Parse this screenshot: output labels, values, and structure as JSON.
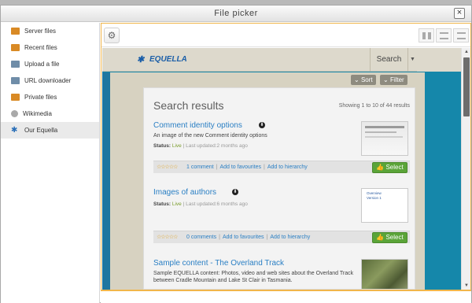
{
  "window": {
    "title": "File picker",
    "close_glyph": "×"
  },
  "sidebar": {
    "items": [
      {
        "label": "Server files",
        "icon": "server-files-icon"
      },
      {
        "label": "Recent files",
        "icon": "recent-files-icon"
      },
      {
        "label": "Upload a file",
        "icon": "upload-icon"
      },
      {
        "label": "URL downloader",
        "icon": "url-downloader-icon"
      },
      {
        "label": "Private files",
        "icon": "private-files-icon"
      },
      {
        "label": "Wikimedia",
        "icon": "wikimedia-icon"
      },
      {
        "label": "Our Equella",
        "icon": "equella-icon",
        "active": true
      }
    ]
  },
  "toolbar": {
    "settings_icon": "gear-icon",
    "view_icons": [
      "grid-view-icon",
      "list-view-icon",
      "tree-view-icon"
    ]
  },
  "equella": {
    "logo_text": "EQUELLA",
    "search_label": "Search",
    "sort_label": "Sort",
    "filter_label": "Filter",
    "results_title": "Search results",
    "results_count": "Showing 1 to 10 of 44 results",
    "status_label": "Status:",
    "results": [
      {
        "title": "Comment identity options",
        "description": "An image of the new Comment identity options",
        "status": "Live",
        "updated": "Last updated:2 months ago",
        "links": [
          "1 comment",
          "Add to favourites",
          "Add to hierarchy"
        ],
        "select_label": "Select"
      },
      {
        "title": "Images of authors",
        "description": "",
        "status": "Live",
        "updated": "Last updated:6 months ago",
        "thumb_text": "Overview\nVersion 1",
        "links": [
          "0 comments",
          "Add to favourites",
          "Add to hierarchy"
        ],
        "select_label": "Select"
      },
      {
        "title": "Sample content - The Overland Track",
        "description": "Sample EQUELLA content: Photos, video and web sites about the Overland Track between Cradle Mountain and Lake St Clair in Tasmania."
      }
    ]
  },
  "colors": {
    "accent": "#f1b64b",
    "brand_blue": "#1587aa",
    "select_green": "#5aa438",
    "link": "#2a7fc4"
  }
}
